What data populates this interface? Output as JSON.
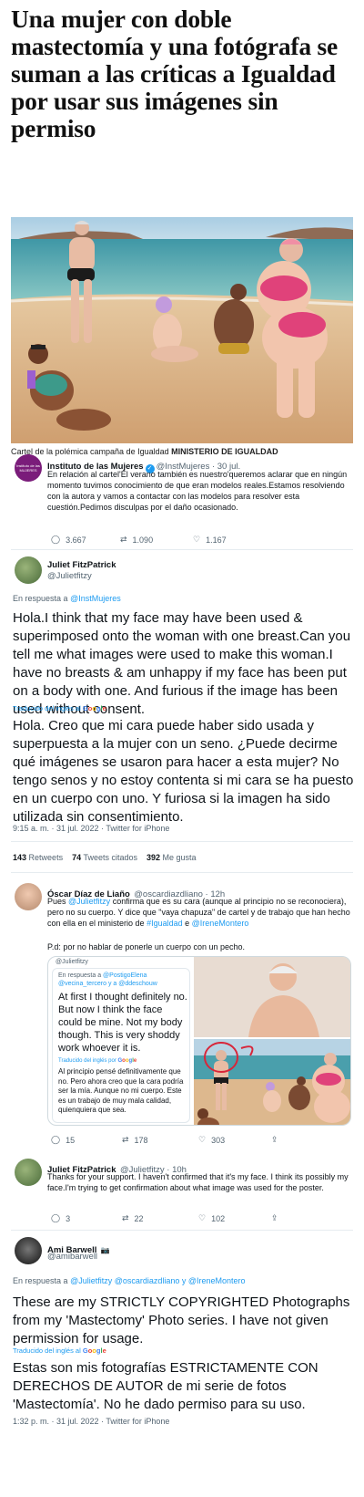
{
  "headline": "Una mujer con doble mastectomía y una fotógrafa se suman a las críticas a Igualdad por usar sus imágenes sin permiso",
  "caption": {
    "text": "Cartel de la polémica campaña de Igualdad",
    "credit": "MINISTERIO DE IGUALDAD"
  },
  "tweet1": {
    "name": "Instituto de las Mujeres",
    "handle": "@InstMujeres · 30 jul.",
    "avatar_text": "Instituto de las MUJERES",
    "text": "En relación al cartel'El verano también es nuestro'queremos aclarar que en ningún momento tuvimos conocimiento de que eran modelos reales.Estamos resolviendo con la autora y vamos a contactar con las modelos para resolver esta cuestión.Pedimos disculpas por el daño ocasionado.",
    "replies": "3.667",
    "retweets": "1.090",
    "likes": "1.167"
  },
  "tweet2": {
    "name": "Juliet FitzPatrick",
    "handle": "@Julietfitzy",
    "reply_label": "En respuesta a",
    "reply_to": "@InstMujeres",
    "text": "Hola.I think that my face may have been used & superimposed onto the woman with one breast.Can you tell me what images were used to make this woman.I have no breasts & am unhappy if my face has been put on a body with one. And furious if the image has been used without consent.",
    "translated_label": "Traducido del inglés al",
    "translation": "Hola. Creo que mi cara puede haber sido usada y superpuesta a la mujer con un seno. ¿Puede decirme qué imágenes se usaron para hacer a esta mujer? No tengo senos y no estoy contenta si mi cara se ha puesto en un cuerpo con uno. Y furiosa si la imagen ha sido utilizada sin consentimiento.",
    "meta": "9:15 a. m. · 31 jul. 2022 · Twitter for iPhone",
    "retweets": "143",
    "retweets_label": "Retweets",
    "quotes": "74",
    "quotes_label": "Tweets citados",
    "likes": "392",
    "likes_label": "Me gusta"
  },
  "tweet3": {
    "name": "Óscar Díaz de Liaño",
    "handle": "@oscardiazdliano · 12h",
    "text_a": "Pues",
    "mention1": "@Julietfitzy",
    "text_b": "confirma que es su cara (aunque al principio no se reconociera), pero no su cuerpo. Y dice que \"vaya chapuza\" de cartel y de trabajo que han hecho con ella en el ministerio de",
    "hashtag": "#Igualdad",
    "text_c": "e",
    "mention2": "@IreneMontero",
    "pd": "P.d: por no hablar de ponerle un cuerpo con un pecho.",
    "embed": {
      "handle": "@Julietfitzy",
      "reply_label": "En respuesta a",
      "reply_to": "@PostigoElena",
      "reply_to2": "@vecina_tercero y a @ddeschouw",
      "text": "At first I thought definitely no. But now I think the face could be mine. Not my body though. This is very shoddy work whoever it is.",
      "translated_label": "Traducido del inglés por",
      "translation": "Al principio pensé definitivamente que no. Pero ahora creo que la cara podría ser la mía. Aunque no mi cuerpo. Este es un trabajo de muy mala calidad, quienquiera que sea."
    },
    "replies": "15",
    "retweets": "178",
    "likes": "303"
  },
  "tweet4": {
    "name": "Juliet FitzPatrick",
    "handle": "@Julietfitzy · 10h",
    "text": "Thanks for your support. I haven't confirmed that it's my face. I think its possibly my face.I'm trying to get confirmation about what image was used for the poster.",
    "replies": "3",
    "retweets": "22",
    "likes": "102"
  },
  "tweet5": {
    "name": "Ami Barwell",
    "badge": "📷",
    "handle": "@amibarwell",
    "reply_label": "En respuesta a",
    "reply_to": "@Julietfitzy @oscardiazdliano y @IreneMontero",
    "text": "These are my STRICTLY COPYRIGHTED Photographs from my 'Mastectomy' Photo series. I have not given permission for usage.",
    "translated_label": "Traducido del inglés al",
    "translation": "Estas son mis fotografías ESTRICTAMENTE CON DERECHOS DE AUTOR de mi serie de fotos 'Mastectomía'. No he dado permiso para su uso.",
    "meta": "1:32 p. m. · 31 jul. 2022 · Twitter for iPhone"
  },
  "google": [
    "G",
    "o",
    "o",
    "g",
    "l",
    "e"
  ],
  "colors": {
    "link": "#1d9bf0",
    "muted": "#536471",
    "sand": "#d9b48a",
    "sea": "#5aa7b0",
    "sky": "#b7d3e4"
  }
}
